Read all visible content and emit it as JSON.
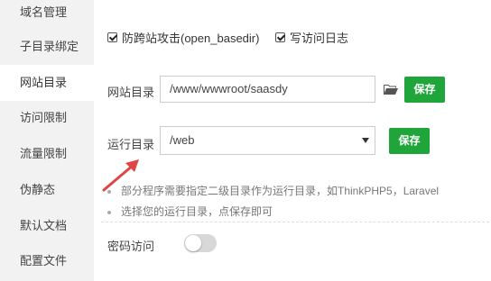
{
  "sidebar": {
    "items": [
      {
        "label": "域名管理"
      },
      {
        "label": "子目录绑定"
      },
      {
        "label": "网站目录",
        "active": true
      },
      {
        "label": "访问限制"
      },
      {
        "label": "流量限制"
      },
      {
        "label": "伪静态"
      },
      {
        "label": "默认文档"
      },
      {
        "label": "配置文件"
      }
    ]
  },
  "options": {
    "anti_xss": {
      "label": "防跨站攻击(open_basedir)",
      "checked": true
    },
    "access_log": {
      "label": "写访问日志",
      "checked": true
    }
  },
  "site_dir": {
    "label": "网站目录",
    "value": "/www/wwwroot/saasdy",
    "save_label": "保存"
  },
  "run_dir": {
    "label": "运行目录",
    "selected": "/web",
    "save_label": "保存"
  },
  "hints": [
    "部分程序需要指定二级目录作为运行目录，如ThinkPHP5，Laravel",
    "选择您的运行目录，点保存即可"
  ],
  "password_access": {
    "label": "密码访问",
    "enabled": false
  },
  "colors": {
    "accent": "#20a53a",
    "arrow": "#e04545"
  }
}
